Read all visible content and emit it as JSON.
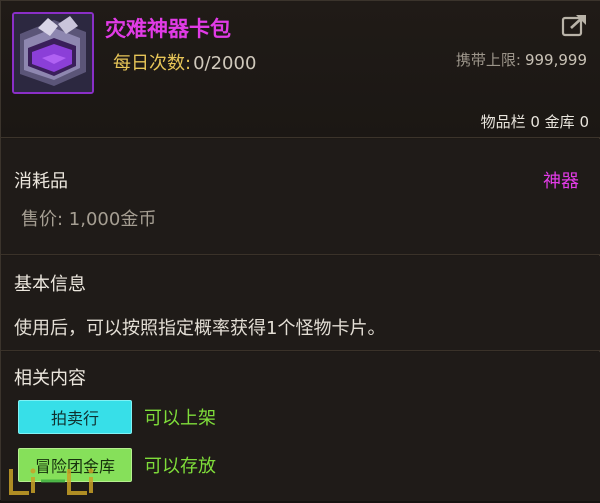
{
  "item": {
    "name": "灾难神器卡包",
    "daily_label": "每日次数:",
    "daily_value": "0/2000",
    "carry_label": "携带上限:",
    "carry_value": "999,999",
    "storage_text": "物品栏 0  金库 0",
    "icon": "card-pack-icon"
  },
  "consumable": {
    "title": "消耗品",
    "type_tag": "神器",
    "price": "售价:  1,000金币"
  },
  "basic": {
    "title": "基本信息",
    "description": "使用后，可以按照指定概率获得1个怪物卡片。"
  },
  "related": {
    "title": "相关内容",
    "rows": [
      {
        "button": "拍卖行",
        "note": "可以上架"
      },
      {
        "button": "冒险团金库",
        "note": "可以存放"
      }
    ]
  },
  "colors": {
    "rarity": "#e13be6",
    "auction": "#37dfe8",
    "bank": "#86e05a",
    "note": "#7fdd3a",
    "label_gold": "#e7c558"
  }
}
